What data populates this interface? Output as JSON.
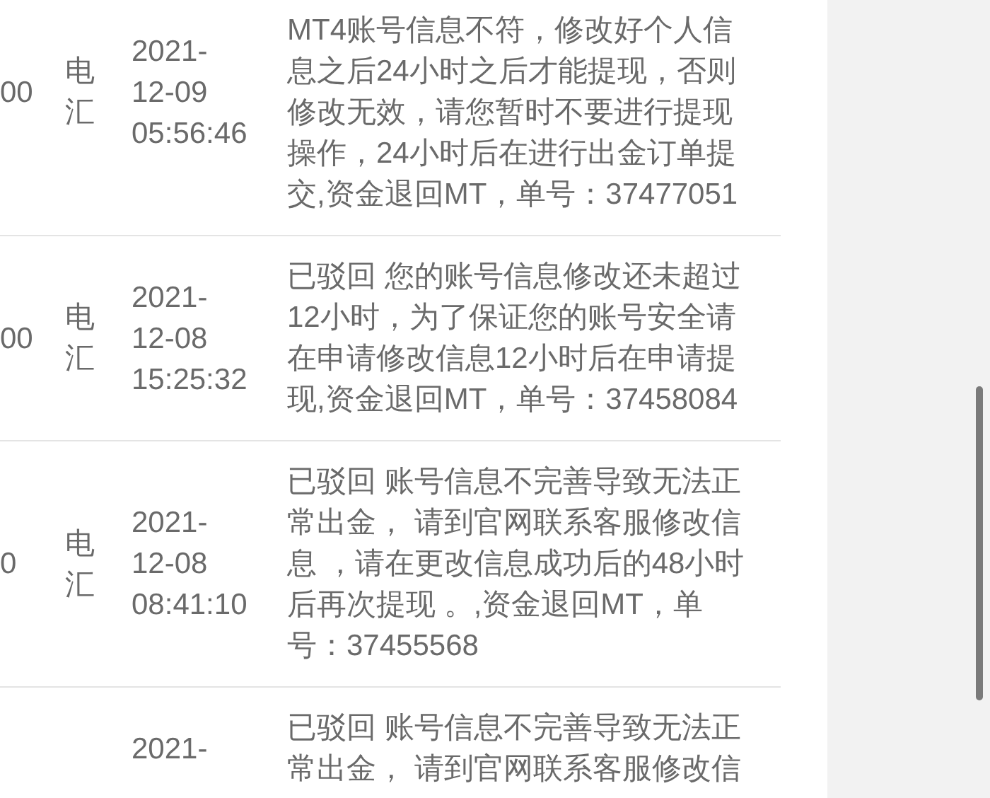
{
  "table": {
    "rows": [
      {
        "amount": "00",
        "method": "电汇",
        "time": "2021-12-09 05:56:46",
        "remark": "MT4账号信息不符，修改好个人信息之后24小时之后才能提现，否则修改无效，请您暂时不要进行提现操作，24小时后在进行出金订单提交,资金退回MT，单号：37477051"
      },
      {
        "amount": "00",
        "method": "电汇",
        "time": "2021-12-08 15:25:32",
        "remark": "已驳回 您的账号信息修改还未超过12小时，为了保证您的账号安全请在申请修改信息12小时后在申请提现,资金退回MT，单号：37458084"
      },
      {
        "amount": "0",
        "method": "电汇",
        "time": "2021-12-08 08:41:10",
        "remark": "已驳回 账号信息不完善导致无法正常出金， 请到官网联系客服修改信息 ，请在更改信息成功后的48小时后再次提现 。,资金退回MT，单号：37455568"
      },
      {
        "time": "2021-",
        "remark": "已驳回 账号信息不完善导致无法正常出金， 请到官网联系客服修改信"
      }
    ]
  }
}
